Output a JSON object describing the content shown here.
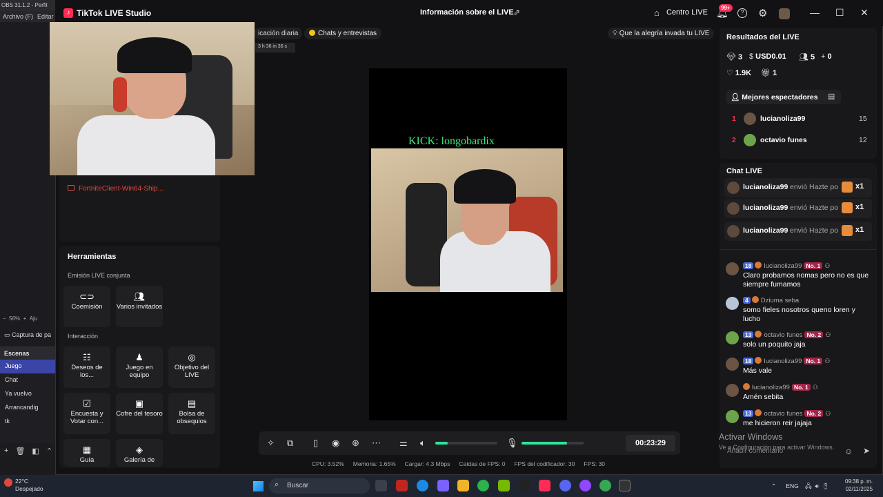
{
  "obs": {
    "title": "OBS 31.1.2 - Perfil",
    "menu": [
      "Archivo (F)",
      "Editar"
    ],
    "zoom": "56%",
    "zoom_extra": "Aju",
    "source_label": "Captura de pa",
    "scenes_header": "Escenas",
    "scenes": [
      "Juego",
      "Chat",
      "Ya vuelvo",
      "Arrancandig",
      "tk"
    ]
  },
  "app": {
    "title": "TikTok LIVE Studio",
    "live_info": "Información sobre el LIVE",
    "centro": "Centro LIVE",
    "notif_badge": "99+"
  },
  "pills": {
    "diaria": "icación diaria",
    "mini_stats": "3 h 36  in 36 s",
    "chats": "Chats y entrevistas",
    "goal": "Que la alegría invada tu LIVE"
  },
  "left": {
    "game_source": "FortniteClient-Win64-Ship...",
    "tools_title": "Herramientas",
    "sect_coemision": "Emisión LIVE conjunta",
    "sect_interaccion": "Interacción",
    "tools_row1": [
      "Coemisión",
      "Varios invitados"
    ],
    "tools_row2": [
      "Deseos de los...",
      "Juego en equipo",
      "Objetivo del LIVE"
    ],
    "tools_row3": [
      "Encuesta y Votar con...",
      "Cofre del tesoro",
      "Bolsa de obsequios"
    ],
    "tools_row4": [
      "Guía",
      "Galería de"
    ]
  },
  "preview": {
    "overlay_text": "KICK: longobardix",
    "timer": "00:23:29",
    "volume_level": 0.2,
    "mic_level": 0.73
  },
  "stats": {
    "cpu": "CPU: 3.52%",
    "mem": "Memoria: 1.65%",
    "load": "Cargar: 4.3 Mbps",
    "fps_drop": "Caídas de FPS: 0",
    "enc_fps": "FPS del codificador: 30",
    "fps": "FPS: 30"
  },
  "results": {
    "title": "Resultados del LIVE",
    "diamonds": "3",
    "usd": "USD0.01",
    "viewers": "5",
    "new_followers": "0",
    "likes": "1.9K",
    "gifts": "1",
    "top_viewers_label": "Mejores espectadores",
    "top_viewers": [
      {
        "rank": "1",
        "name": "lucianoliza99",
        "score": "15"
      },
      {
        "rank": "2",
        "name": "octavio funes",
        "score": "12"
      }
    ]
  },
  "chat": {
    "title": "Chat LIVE",
    "gifts": [
      {
        "user": "lucianoliza99",
        "text": "envió Hazte po",
        "count": "x1"
      },
      {
        "user": "lucianoliza99",
        "text": "envió Hazte po",
        "count": "x1"
      },
      {
        "user": "lucianoliza99",
        "text": "envió Hazte po",
        "count": "x1"
      }
    ],
    "messages": [
      {
        "level": "18",
        "user": "lucianoliza99",
        "rank": "No. 1",
        "text": "Claro probamos nomas pero no es que siempre fumamos"
      },
      {
        "level": "4",
        "user": "Dziuma seba",
        "rank": "",
        "text": "somo fieles nosotros queno loren y lucho"
      },
      {
        "level": "13",
        "user": "octavio funes",
        "rank": "No. 2",
        "text": "solo un poquito jaja"
      },
      {
        "level": "18",
        "user": "lucianoliza99",
        "rank": "No. 1",
        "text": "Más vale"
      },
      {
        "level": "",
        "user": "lucianoliza99",
        "rank": "No. 1",
        "text": "Amén sebita"
      },
      {
        "level": "13",
        "user": "octavio funes",
        "rank": "No. 2",
        "text": "me hicieron reir jajaja"
      }
    ],
    "comment_placeholder": "Añadir comentario",
    "activate_title": "Activar Windows",
    "activate_sub": "Ve a Configuración para activar Windows."
  },
  "taskbar": {
    "temp": "22°C",
    "weather": "Despejado",
    "search": "Buscar",
    "lang": "ENG",
    "time": "09:38 p. m.",
    "date": "02/11/2025"
  },
  "colors": {
    "accent": "#fe2c55",
    "green": "#2fe59b",
    "kick": "#3ee87a"
  }
}
